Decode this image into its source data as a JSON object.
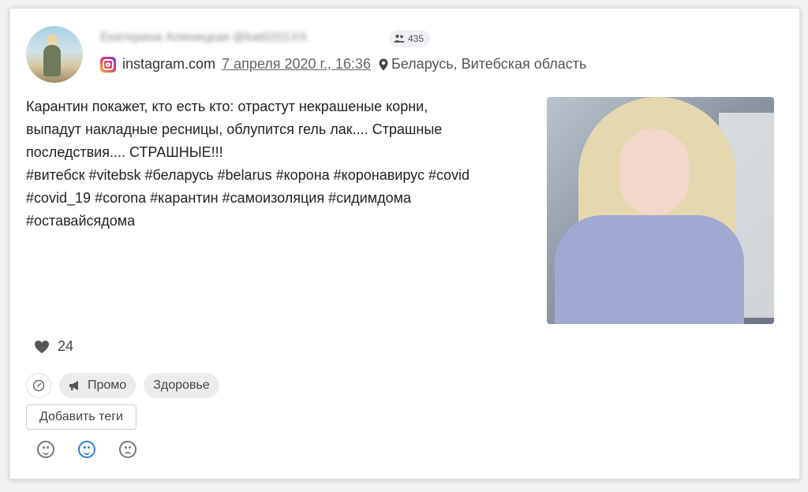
{
  "post": {
    "author_name": "Екатерина Аленицкая @kat0201XX",
    "followers": "435",
    "source": "instagram.com",
    "date": "7 апреля 2020 г., 16:36",
    "location": "Беларусь, Витебская область",
    "text_lines": [
      "Карантин покажет, кто есть кто: отрастут некрашеные корни,",
      "выпадут накладные ресницы, облупится гель лак.... Страшные",
      "последствия.... СТРАШНЫЕ!!!",
      "#витебск #vitebsk #беларусь #belarus #корона #коронавирус #covid",
      "#covid_19 #corona #карантин #самоизоляция #сидимдома",
      "#оставайсядома"
    ],
    "likes": "24"
  },
  "tags": {
    "promo_label": "Промо",
    "health_label": "Здоровье",
    "add_tags_label": "Добавить теги"
  },
  "icons": {
    "followers": "people-icon",
    "source": "instagram-icon",
    "location": "map-pin-icon",
    "likes": "heart-icon",
    "edit": "edit-pencil-icon",
    "promo": "megaphone-icon",
    "reactions": [
      "positive-face-icon",
      "neutral-face-icon",
      "negative-face-icon"
    ]
  },
  "colors": {
    "accent": "#2f7fd8"
  }
}
